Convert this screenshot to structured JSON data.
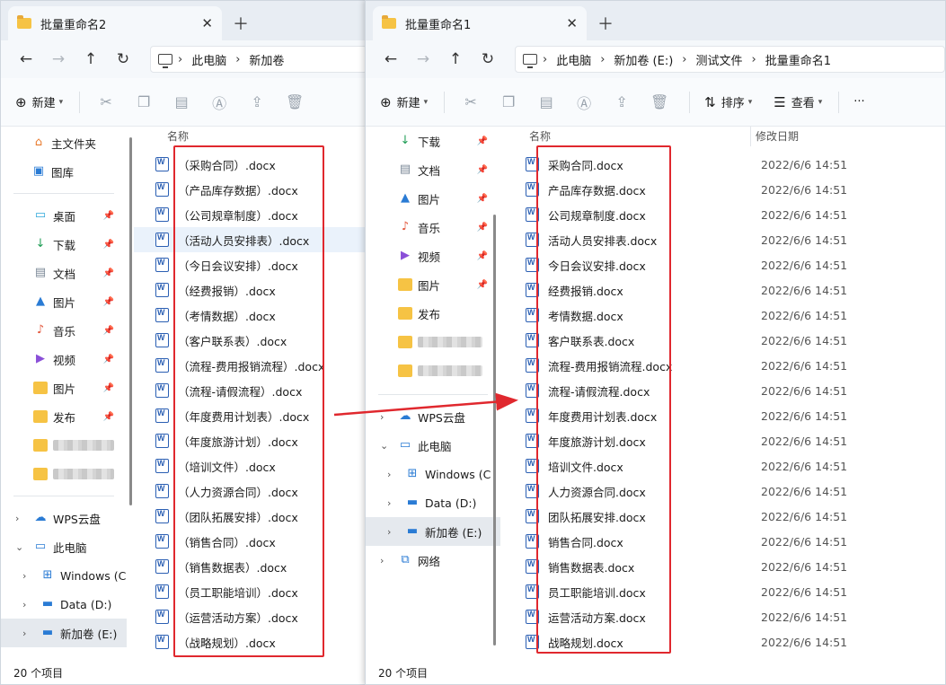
{
  "left_window": {
    "tab_title": "批量重命名2",
    "breadcrumbs": [
      "此电脑",
      "新加卷"
    ],
    "toolbar": {
      "new_label": "新建"
    },
    "sidebar": {
      "top_items": [
        {
          "label": "主文件夹",
          "icon": "home-icon",
          "color": "#e87a2c"
        },
        {
          "label": "图库",
          "icon": "gallery-icon",
          "color": "#2a7bd4"
        }
      ],
      "pinned_items": [
        {
          "label": "桌面",
          "icon": "desktop-icon",
          "color": "#2ba6d9"
        },
        {
          "label": "下载",
          "icon": "download-icon",
          "color": "#1f9d55"
        },
        {
          "label": "文档",
          "icon": "document-icon",
          "color": "#7a8796"
        },
        {
          "label": "图片",
          "icon": "picture-icon",
          "color": "#2a7bd4"
        },
        {
          "label": "音乐",
          "icon": "music-icon",
          "color": "#e2563b"
        },
        {
          "label": "视频",
          "icon": "video-icon",
          "color": "#8a4fd8"
        },
        {
          "label": "图片",
          "icon": "folder-icon",
          "color": "#f6c344"
        },
        {
          "label": "发布",
          "icon": "folder-icon",
          "color": "#f6c344"
        }
      ],
      "tree_items": [
        {
          "label": "WPS云盘",
          "icon": "cloud-icon"
        },
        {
          "label": "此电脑",
          "icon": "computer-icon"
        },
        {
          "label": "Windows (C",
          "icon": "windows-drive-icon"
        },
        {
          "label": "Data (D:)",
          "icon": "drive-icon"
        },
        {
          "label": "新加卷 (E:)",
          "icon": "drive-icon"
        }
      ]
    },
    "column_name": "名称",
    "files": [
      "（采购合同）.docx",
      "（产品库存数据）.docx",
      "（公司规章制度）.docx",
      "（活动人员安排表）.docx",
      "（今日会议安排）.docx",
      "（经费报销）.docx",
      "（考情数据）.docx",
      "（客户联系表）.docx",
      "（流程-费用报销流程）.docx",
      "（流程-请假流程）.docx",
      "（年度费用计划表）.docx",
      "（年度旅游计划）.docx",
      "（培训文件）.docx",
      "（人力资源合同）.docx",
      "（团队拓展安排）.docx",
      "（销售合同）.docx",
      "（销售数据表）.docx",
      "（员工职能培训）.docx",
      "（运营活动方案）.docx",
      "（战略规划）.docx"
    ],
    "status": "20 个项目"
  },
  "right_window": {
    "tab_title": "批量重命名1",
    "breadcrumbs": [
      "此电脑",
      "新加卷 (E:)",
      "测试文件",
      "批量重命名1"
    ],
    "toolbar": {
      "new_label": "新建",
      "sort_label": "排序",
      "view_label": "查看",
      "more_label": "···"
    },
    "sidebar": {
      "pinned_items": [
        {
          "label": "下载",
          "icon": "download-icon",
          "color": "#1f9d55"
        },
        {
          "label": "文档",
          "icon": "document-icon",
          "color": "#7a8796"
        },
        {
          "label": "图片",
          "icon": "picture-icon",
          "color": "#2a7bd4"
        },
        {
          "label": "音乐",
          "icon": "music-icon",
          "color": "#e2563b"
        },
        {
          "label": "视频",
          "icon": "video-icon",
          "color": "#8a4fd8"
        },
        {
          "label": "图片",
          "icon": "folder-icon",
          "color": "#f6c344"
        }
      ],
      "unpinned_items": [
        {
          "label": "发布",
          "icon": "folder-icon",
          "color": "#f6c344"
        }
      ],
      "tree_items": [
        {
          "label": "WPS云盘",
          "icon": "cloud-icon"
        },
        {
          "label": "此电脑",
          "icon": "computer-icon"
        },
        {
          "label": "Windows (C",
          "icon": "windows-drive-icon"
        },
        {
          "label": "Data (D:)",
          "icon": "drive-icon"
        },
        {
          "label": "新加卷 (E:)",
          "icon": "drive-icon"
        },
        {
          "label": "网络",
          "icon": "network-icon"
        }
      ]
    },
    "column_name": "名称",
    "column_date": "修改日期",
    "files": [
      "采购合同.docx",
      "产品库存数据.docx",
      "公司规章制度.docx",
      "活动人员安排表.docx",
      "今日会议安排.docx",
      "经费报销.docx",
      "考情数据.docx",
      "客户联系表.docx",
      "流程-费用报销流程.docx",
      "流程-请假流程.docx",
      "年度费用计划表.docx",
      "年度旅游计划.docx",
      "培训文件.docx",
      "人力资源合同.docx",
      "团队拓展安排.docx",
      "销售合同.docx",
      "销售数据表.docx",
      "员工职能培训.docx",
      "运营活动方案.docx",
      "战略规划.docx"
    ],
    "file_date": "2022/6/6 14:51",
    "status": "20 个项目"
  },
  "colors": {
    "accent_red": "#e0282e",
    "folder_yellow": "#f6c344",
    "word_blue": "#2b5fb3"
  }
}
